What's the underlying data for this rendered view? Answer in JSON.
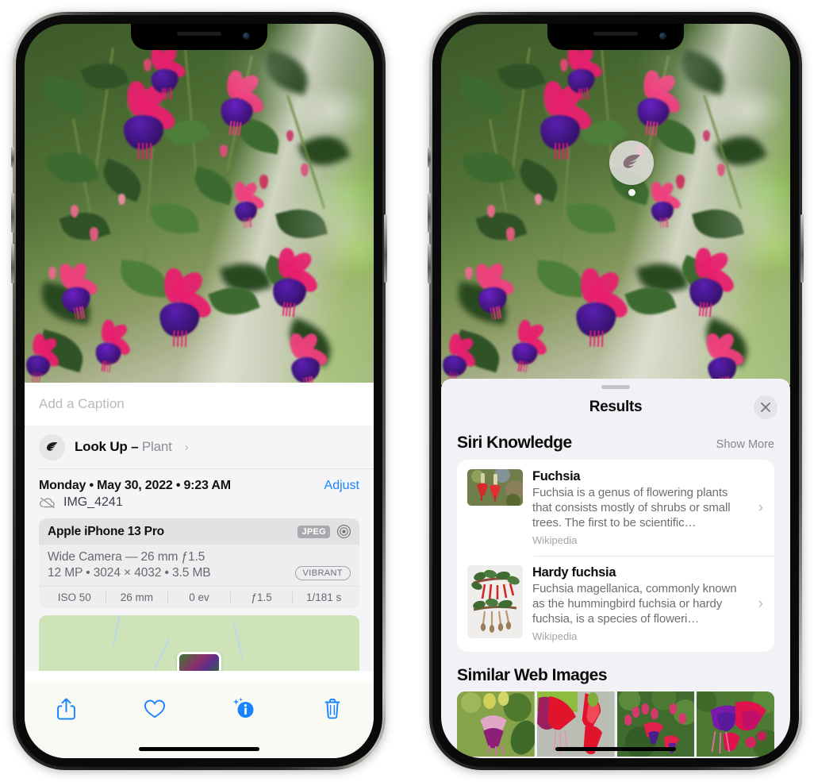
{
  "left_phone": {
    "name": "Photos app — photo info view",
    "caption_input": {
      "placeholder": "Add a Caption",
      "value": ""
    },
    "lookup": {
      "icon": "leaf-icon",
      "label": "Look Up",
      "separator": "–",
      "subject": "Plant",
      "chevron": "›"
    },
    "date": "Monday • May 30, 2022 • 9:23 AM",
    "adjust_label": "Adjust",
    "filename": "IMG_4241",
    "cloud_icon": "cloud-slash-icon",
    "exif": {
      "device": "Apple iPhone 13 Pro",
      "format_badge": "JPEG",
      "aperture_icon": "aperture-icon",
      "lens_line": "Wide Camera — 26 mm ƒ1.5",
      "size_line": "12 MP • 3024 × 4032 • 3.5 MB",
      "style_badge": "VIBRANT",
      "stats": [
        "ISO 50",
        "26 mm",
        "0 ev",
        "ƒ1.5",
        "1/181 s"
      ]
    },
    "toolbar": [
      {
        "name": "share-icon",
        "label": "Share"
      },
      {
        "name": "heart-icon",
        "label": "Favorite"
      },
      {
        "name": "info-sparkle-icon",
        "label": "Info"
      },
      {
        "name": "trash-icon",
        "label": "Delete"
      }
    ],
    "accent_color": "#1a84ff"
  },
  "right_phone": {
    "name": "Visual Look Up results",
    "photo_badge": {
      "icon": "leaf-icon",
      "label": "Plant subject indicator"
    },
    "sheet": {
      "title": "Results",
      "close_icon": "close-icon",
      "grabber": "drag-handle"
    },
    "siri_knowledge": {
      "title": "Siri Knowledge",
      "action": "Show More",
      "items": [
        {
          "title": "Fuchsia",
          "description": "Fuchsia is a genus of flowering plants that consists mostly of shrubs or small trees. The first to be scientific…",
          "source": "Wikipedia",
          "chevron": "›"
        },
        {
          "title": "Hardy fuchsia",
          "description": "Fuchsia magellanica, commonly known as the hummingbird fuchsia or hardy fuchsia, is a species of floweri…",
          "source": "Wikipedia",
          "chevron": "›"
        }
      ]
    },
    "similar_web_images": {
      "title": "Similar Web Images",
      "thumbnails": [
        "fuchsia-magenta-white-bloom",
        "fuchsia-red-closeup",
        "fuchsia-shrub-buds",
        "fuchsia-purple-red-cluster"
      ]
    }
  },
  "colors": {
    "accent_blue": "#1a84ff",
    "sheet_gray": "#f2f2f6",
    "card_white": "#ffffff",
    "secondary_text": "#6e6e73",
    "tertiary_text": "#a3a3a9"
  }
}
